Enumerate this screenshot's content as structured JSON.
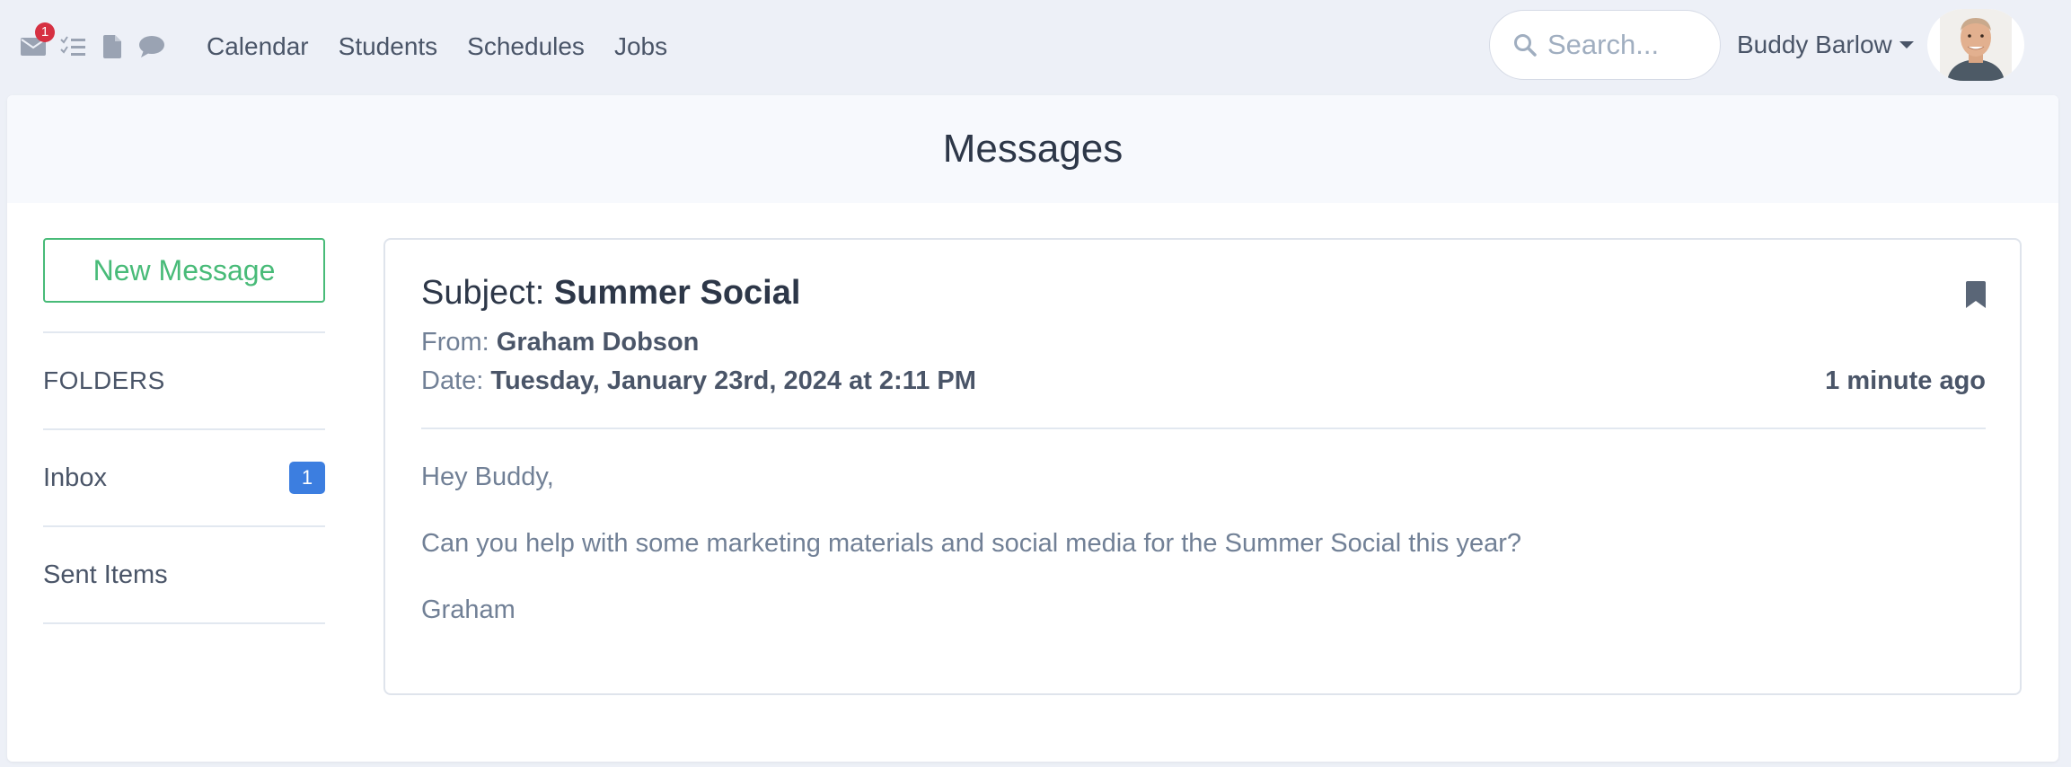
{
  "nav": {
    "icons": [
      {
        "name": "envelope-icon",
        "badge": "1"
      },
      {
        "name": "checklist-icon"
      },
      {
        "name": "file-icon"
      },
      {
        "name": "chat-bubble-icon"
      }
    ],
    "links": [
      "Calendar",
      "Students",
      "Schedules",
      "Jobs"
    ],
    "search_placeholder": "Search...",
    "user_name": "Buddy Barlow"
  },
  "page": {
    "title": "Messages"
  },
  "sidebar": {
    "new_message_label": "New Message",
    "folders_heading": "FOLDERS",
    "folders": [
      {
        "label": "Inbox",
        "count": "1"
      },
      {
        "label": "Sent Items"
      }
    ]
  },
  "message": {
    "subject_prefix": "Subject:",
    "subject": "Summer Social",
    "from_label": "From:",
    "from": "Graham Dobson",
    "date_label": "Date:",
    "date": "Tuesday, January 23rd, 2024 at 2:11 PM",
    "relative_time": "1 minute ago",
    "body": [
      "Hey Buddy,",
      "Can you help with some marketing materials and social media for the Summer Social this year?",
      "Graham"
    ]
  },
  "colors": {
    "accent_green": "#48bb78",
    "badge_blue": "#3c7ee0",
    "badge_red": "#d63042",
    "background": "#edf0f7"
  }
}
